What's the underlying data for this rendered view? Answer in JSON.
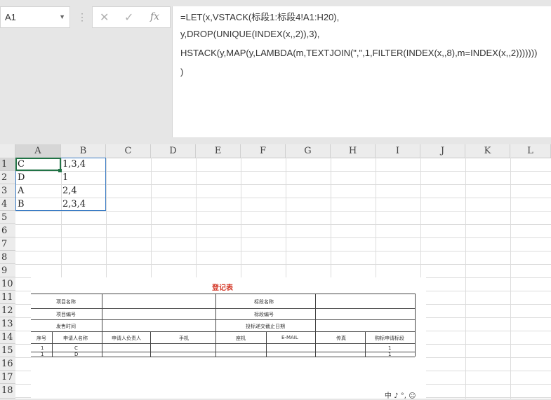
{
  "name_box": {
    "value": "A1"
  },
  "formula_bar": {
    "more_icon": "⋮",
    "cancel_icon": "✕",
    "enter_icon": "✓",
    "fx_label": "fx",
    "lines": [
      "=LET(x,VSTACK(标段1:标段4!A1:H20),",
      "y,DROP(UNIQUE(INDEX(x,,2)),3),",
      "HSTACK(y,MAP(y,LAMBDA(m,TEXTJOIN(\",\",1,FILTER(INDEX(x,,8),m=INDEX(x,,2)))))))",
      ")"
    ]
  },
  "columns": [
    "A",
    "B",
    "C",
    "D",
    "E",
    "F",
    "G",
    "H",
    "I",
    "J",
    "K",
    "L"
  ],
  "rows": [
    "1",
    "2",
    "3",
    "4",
    "5",
    "6",
    "7",
    "8",
    "9",
    "10",
    "11",
    "12",
    "13",
    "14",
    "15",
    "16",
    "17",
    "18"
  ],
  "cells": {
    "A1": "C",
    "B1": "1,3,4",
    "A2": "D",
    "B2": "1",
    "A3": "A",
    "B3": "2,4",
    "A4": "B",
    "B4": "2,3,4"
  },
  "form_image": {
    "title": "登记表",
    "project_name": "项目名称",
    "section_name": "标段名称",
    "project_no": "项目编号",
    "section_no": "标段编号",
    "sale_time": "发售时间",
    "deadline": "投标递交截止日期",
    "headers": [
      "序号",
      "申请人名称",
      "申请人负责人",
      "手机",
      "座机",
      "E-MAIL",
      "传真",
      "购标申请标段"
    ],
    "rows": [
      {
        "no": "1",
        "name": "C",
        "section": "1"
      },
      {
        "no": "1",
        "name": "D",
        "section": "1"
      }
    ]
  },
  "ime_bar": {
    "text": "中 ♪ °, ☺"
  }
}
